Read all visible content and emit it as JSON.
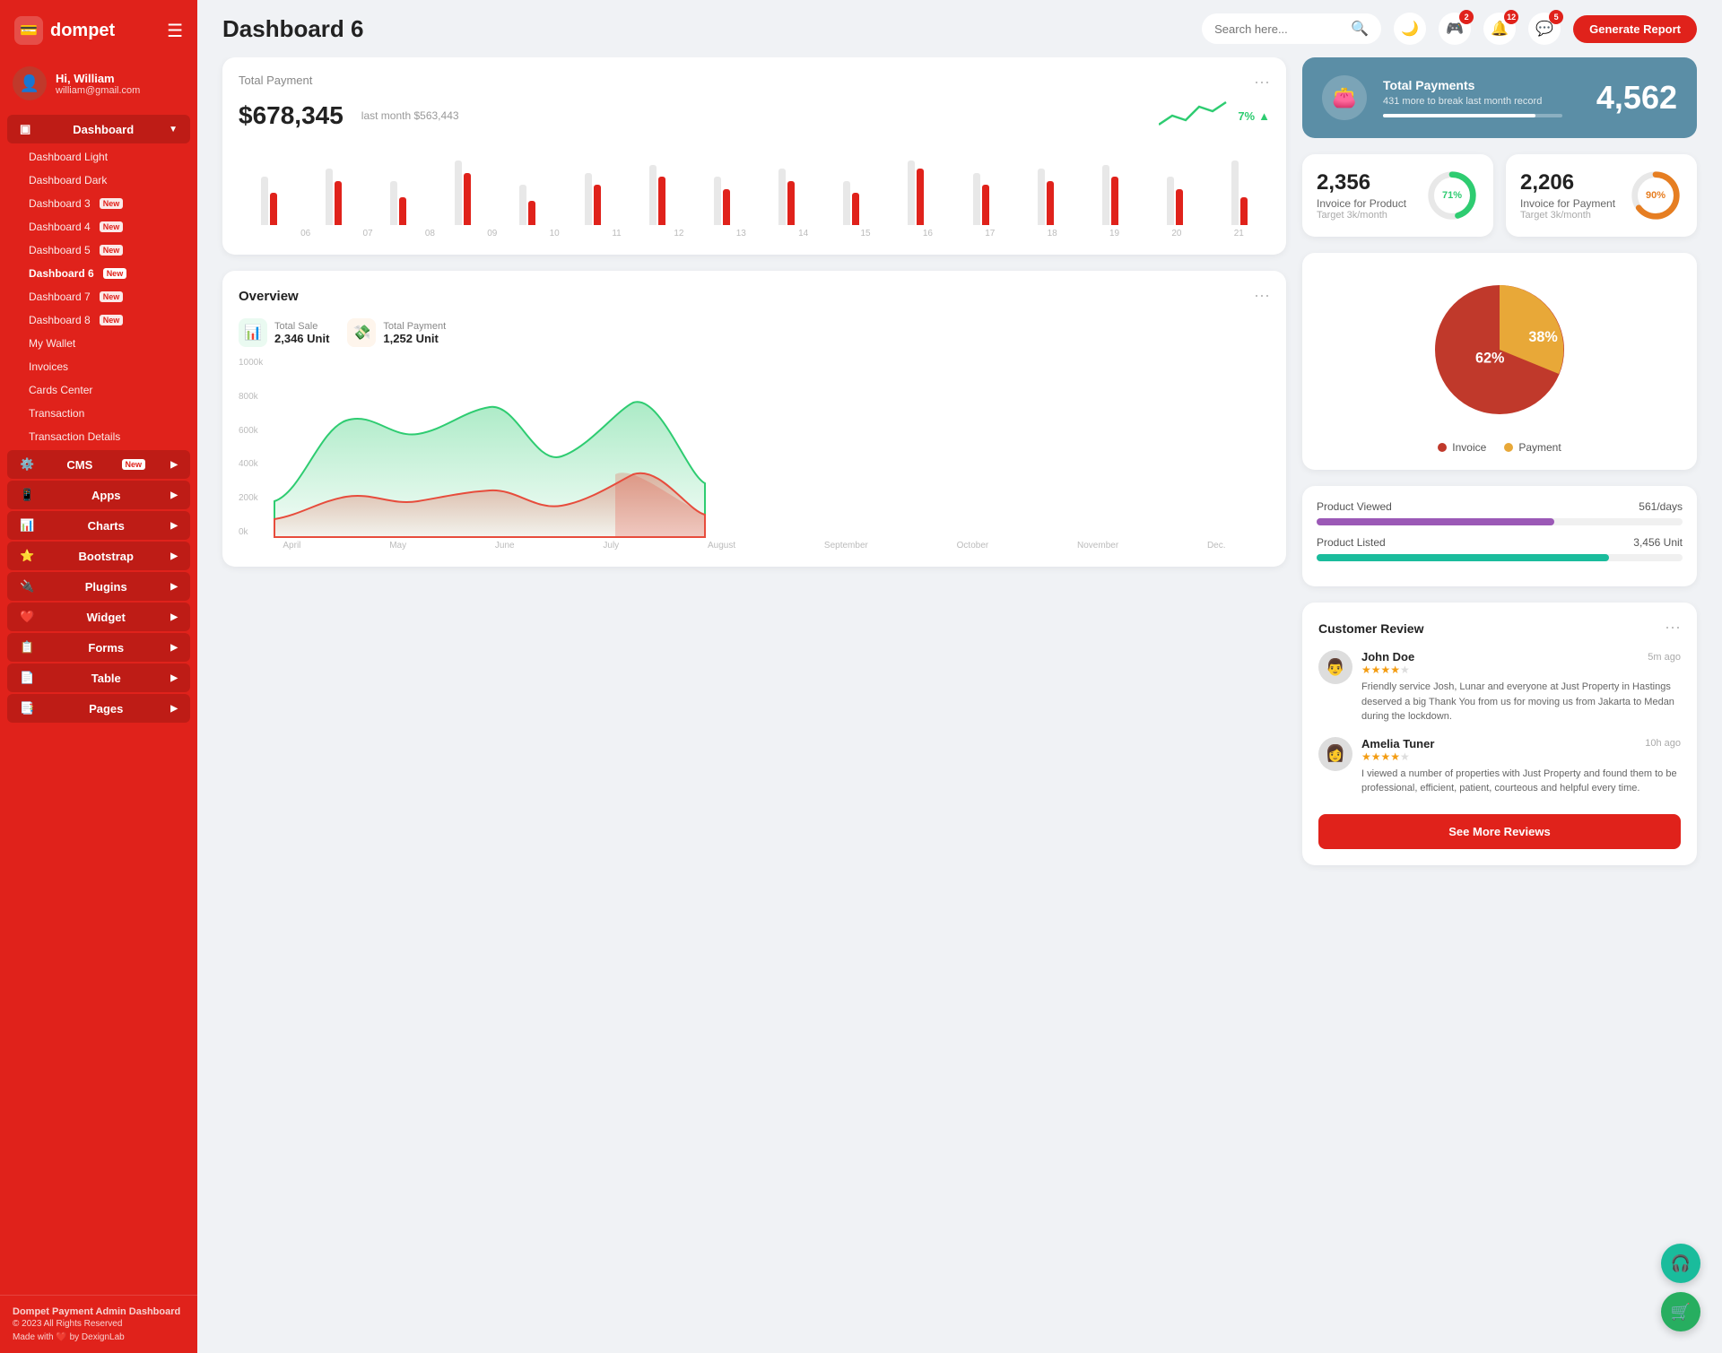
{
  "brand": {
    "name": "dompet",
    "logo_icon": "💳"
  },
  "user": {
    "name": "Hi, William",
    "email": "william@gmail.com",
    "avatar": "👤"
  },
  "topbar": {
    "title": "Dashboard 6",
    "search_placeholder": "Search here...",
    "generate_report_label": "Generate Report",
    "notifications": [
      {
        "icon": "🎮",
        "count": "2"
      },
      {
        "icon": "🔔",
        "count": "12"
      },
      {
        "icon": "💬",
        "count": "5"
      }
    ]
  },
  "sidebar": {
    "dashboard_label": "Dashboard",
    "items": [
      {
        "label": "Dashboard Light",
        "active": false,
        "badge": ""
      },
      {
        "label": "Dashboard Dark",
        "active": false,
        "badge": ""
      },
      {
        "label": "Dashboard 3",
        "active": false,
        "badge": "New"
      },
      {
        "label": "Dashboard 4",
        "active": false,
        "badge": "New"
      },
      {
        "label": "Dashboard 5",
        "active": false,
        "badge": "New"
      },
      {
        "label": "Dashboard 6",
        "active": true,
        "badge": "New"
      },
      {
        "label": "Dashboard 7",
        "active": false,
        "badge": "New"
      },
      {
        "label": "Dashboard 8",
        "active": false,
        "badge": "New"
      },
      {
        "label": "My Wallet",
        "active": false,
        "badge": ""
      },
      {
        "label": "Invoices",
        "active": false,
        "badge": ""
      },
      {
        "label": "Cards Center",
        "active": false,
        "badge": ""
      },
      {
        "label": "Transaction",
        "active": false,
        "badge": ""
      },
      {
        "label": "Transaction Details",
        "active": false,
        "badge": ""
      }
    ],
    "nav_items": [
      {
        "label": "CMS",
        "badge": "New",
        "icon": "⚙️",
        "has_arrow": true
      },
      {
        "label": "Apps",
        "badge": "",
        "icon": "📱",
        "has_arrow": true
      },
      {
        "label": "Charts",
        "badge": "",
        "icon": "📊",
        "has_arrow": true
      },
      {
        "label": "Bootstrap",
        "badge": "",
        "icon": "⭐",
        "has_arrow": true
      },
      {
        "label": "Plugins",
        "badge": "",
        "icon": "🔌",
        "has_arrow": true
      },
      {
        "label": "Widget",
        "badge": "",
        "icon": "❤️",
        "has_arrow": true
      },
      {
        "label": "Forms",
        "badge": "",
        "icon": "📋",
        "has_arrow": true
      },
      {
        "label": "Table",
        "badge": "",
        "icon": "📄",
        "has_arrow": true
      },
      {
        "label": "Pages",
        "badge": "",
        "icon": "📑",
        "has_arrow": true
      }
    ]
  },
  "footer": {
    "title": "Dompet Payment Admin Dashboard",
    "copyright": "© 2023 All Rights Reserved",
    "made_with": "Made with ❤️ by DexignLab"
  },
  "total_payment": {
    "title": "Total Payment",
    "amount": "$678,345",
    "last_month_label": "last month $563,443",
    "trend_pct": "7%",
    "trend_arrow": "↑",
    "bars": [
      {
        "gray": 60,
        "red": 40
      },
      {
        "gray": 70,
        "red": 55
      },
      {
        "gray": 55,
        "red": 35
      },
      {
        "gray": 80,
        "red": 65
      },
      {
        "gray": 50,
        "red": 30
      },
      {
        "gray": 65,
        "red": 50
      },
      {
        "gray": 75,
        "red": 60
      },
      {
        "gray": 60,
        "red": 45
      },
      {
        "gray": 70,
        "red": 55
      },
      {
        "gray": 55,
        "red": 40
      },
      {
        "gray": 80,
        "red": 70
      },
      {
        "gray": 65,
        "red": 50
      },
      {
        "gray": 70,
        "red": 55
      },
      {
        "gray": 75,
        "red": 60
      },
      {
        "gray": 60,
        "red": 45
      },
      {
        "gray": 80,
        "red": 35
      }
    ],
    "labels": [
      "06",
      "07",
      "08",
      "09",
      "10",
      "11",
      "12",
      "13",
      "14",
      "15",
      "16",
      "17",
      "18",
      "19",
      "20",
      "21"
    ]
  },
  "total_payments_card": {
    "title": "Total Payments",
    "sub": "431 more to break last month record",
    "value": "4,562",
    "progress": 85
  },
  "invoice_product": {
    "value": "2,356",
    "label": "Invoice for Product",
    "target": "Target 3k/month",
    "pct": 71,
    "color": "#2ecc71"
  },
  "invoice_payment": {
    "value": "2,206",
    "label": "Invoice for Payment",
    "target": "Target 3k/month",
    "pct": 90,
    "color": "#e67e22"
  },
  "overview": {
    "title": "Overview",
    "total_sale_label": "Total Sale",
    "total_sale_value": "2,346 Unit",
    "total_payment_label": "Total Payment",
    "total_payment_value": "1,252 Unit",
    "y_labels": [
      "1000k",
      "800k",
      "600k",
      "400k",
      "200k",
      "0k"
    ],
    "x_labels": [
      "April",
      "May",
      "June",
      "July",
      "August",
      "September",
      "October",
      "November",
      "Dec."
    ]
  },
  "pie_chart": {
    "invoice_pct": 62,
    "payment_pct": 38,
    "invoice_label": "Invoice",
    "payment_label": "Payment",
    "invoice_color": "#c0392b",
    "payment_color": "#e8a838"
  },
  "product_viewed": {
    "label": "Product Viewed",
    "value": "561/days",
    "color": "#9b59b6",
    "pct": 65
  },
  "product_listed": {
    "label": "Product Listed",
    "value": "3,456 Unit",
    "color": "#1abc9c",
    "pct": 80
  },
  "customer_review": {
    "title": "Customer Review",
    "see_more_label": "See More Reviews",
    "reviews": [
      {
        "name": "John Doe",
        "time": "5m ago",
        "stars": 4,
        "text": "Friendly service Josh, Lunar and everyone at Just Property in Hastings deserved a big Thank You from us for moving us from Jakarta to Medan during the lockdown.",
        "avatar": "👨"
      },
      {
        "name": "Amelia Tuner",
        "time": "10h ago",
        "stars": 4,
        "text": "I viewed a number of properties with Just Property and found them to be professional, efficient, patient, courteous and helpful every time.",
        "avatar": "👩"
      }
    ]
  }
}
